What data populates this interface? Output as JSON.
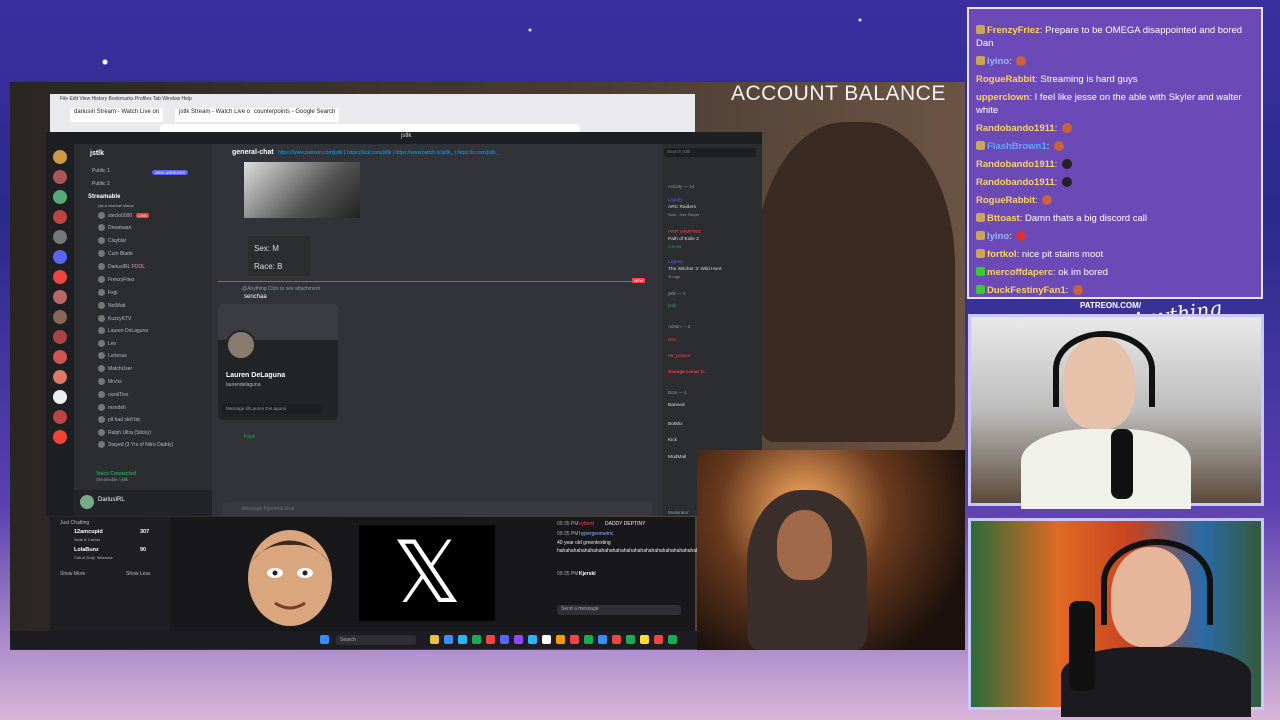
{
  "overlay": {
    "account_balance": "ACCOUNT BALANCE",
    "patreon_label": "PATREON.COM/",
    "signature": "Anything Else?"
  },
  "browser": {
    "menu": "File  Edit  View  History  Bookmarks  Profiles  Tab  Window  Help",
    "tabs": [
      "dariusiri Stream - Watch Live on",
      "jstlk Stream - Watch Live on",
      "counterpoints - Google Search"
    ]
  },
  "discord": {
    "title": "jstlk",
    "server_name": "jstlk",
    "new_unreads": "NEW UNREADS",
    "categories": [
      "Public 1",
      "Public 2",
      "Streamable"
    ],
    "streamable_sub": "(as a channel status",
    "voice_users": [
      {
        "name": "steclo0000",
        "live": "LIVE"
      },
      {
        "name": "Dreamaan"
      },
      {
        "name": "Clayblar"
      },
      {
        "name": "Cum Blade"
      },
      {
        "name": "DariusIRL",
        "tag": "FOOL"
      },
      {
        "name": "FrenzyFriez"
      },
      {
        "name": "Fxgi"
      },
      {
        "name": "NotMatt"
      },
      {
        "name": "KuzzyKTV"
      },
      {
        "name": "Lauren DeLaguna"
      },
      {
        "name": "Lev"
      },
      {
        "name": "Lorlesus"
      },
      {
        "name": "MatchUser"
      },
      {
        "name": "Mrchs"
      },
      {
        "name": "ouralTios"
      },
      {
        "name": "mxndeh"
      },
      {
        "name": "plt bad skill btc"
      },
      {
        "name": "Ralph Ultra (Sticky)"
      },
      {
        "name": "Stayed (3 Yrs of Nitro Daddy)"
      }
    ],
    "voice_connected": "Voice Connected",
    "voice_sub": "Streamable / jstlk",
    "self_user": "DariusIRL",
    "self_status": "In voice",
    "channel_name": "general-chat",
    "channel_links": "https://www.patreon.com/jstlk | https://kick.com/jstlk | https://www.twitch.tv/jstlk_ | https://x.com/jstlk_",
    "message_box": {
      "line1": "Sex: M",
      "line2": "Race: B"
    },
    "new_tag": "NEW",
    "attachment_msg": "@Anything Click to see attachment",
    "reply_user": "senchaa",
    "popup": {
      "name": "Lauren DeLaguna",
      "username": "laurendelaguna",
      "message_placeholder": "Message @Lauren DeLaguna"
    },
    "last_msg_user": "Fapn",
    "composer_placeholder": "Message #general-chat",
    "search_placeholder": "Search jstlk",
    "members": {
      "activity_header": "Activity — 14",
      "activities": [
        {
          "user": "Lrguey",
          "game": "ARC Raiders",
          "sub": "Solo - Dev Player"
        },
        {
          "user": "PRR VAMPIRE",
          "game": "Path of Exile 2",
          "sub": "2:19:54"
        },
        {
          "user": "Lrguey",
          "game": "The Witcher 3: Wild Hunt",
          "sub": "3h ago"
        }
      ],
      "owner_header": "jstlk — 1",
      "owner": "jstlk",
      "admin_header": "Admin — 3",
      "admins": [
        "Riot",
        "Mr_poison",
        "Savage Lunar C."
      ],
      "bots_header": "Bots — 4",
      "bots": [
        "Banned",
        "BotMix",
        "Kick",
        "ModMail"
      ],
      "moderator_header": "Moderator"
    }
  },
  "twitch_sidebar": {
    "section": "Just Chatting",
    "channels": [
      {
        "name": "12amcupid",
        "category": "Slots & Casino",
        "viewers": "307"
      },
      {
        "name": "LolaBunz",
        "category": "Call of Duty: Warzone",
        "viewers": "90"
      }
    ],
    "show_more": "Show More",
    "show_less": "Show Less"
  },
  "twitch_chat": {
    "messages": [
      {
        "time": "09:35 PM",
        "user": "cyberd",
        "text": "DADDY DEPTINY"
      },
      {
        "time": "09:35 PM",
        "user": "hypergeometric",
        "text": "40 year old greentexting hahahahahahahahahahahahahahahahahahahahahahahahahahahahahaha"
      },
      {
        "time": "09:35 PM",
        "user": "Kjerski",
        "text": ""
      }
    ],
    "send_placeholder": "Send a message"
  },
  "taskbar": {
    "search": "Search"
  },
  "stream_chat": [
    {
      "user": "FrenzyFriez",
      "color": "#ffd25a",
      "text": "Prepare to be OMEGA disappointed and bored Dan"
    },
    {
      "user": "lyino",
      "color": "#9ab7ff",
      "text": ""
    },
    {
      "user": "RogueRabbit",
      "color": "#ffd25a",
      "text": "Streaming is hard guys"
    },
    {
      "user": "upperclown",
      "color": "#ffd25a",
      "text": "I feel like jesse on the able with Skyler and walter white"
    },
    {
      "user": "Randobando1911",
      "color": "#ffd25a",
      "text": ""
    },
    {
      "user": "FlashBrown1",
      "color": "#63a6ff",
      "text": ""
    },
    {
      "user": "Randobando1911",
      "color": "#ffd25a",
      "text": ""
    },
    {
      "user": "Randobando1911",
      "color": "#ffd25a",
      "text": ""
    },
    {
      "user": "RogueRabbit",
      "color": "#ffd25a",
      "text": ""
    },
    {
      "user": "Bttoast",
      "color": "#ffd25a",
      "text": "Damn thats a big discord call"
    },
    {
      "user": "lyino",
      "color": "#9ab7ff",
      "text": ""
    },
    {
      "user": "fortkol",
      "color": "#ffd25a",
      "text": "nice pit stains moot"
    },
    {
      "user": "mercoffdaperc",
      "color": "#ffd25a",
      "text": "ok im bored"
    },
    {
      "user": "DuckFestinyFan1",
      "color": "#ffd25a",
      "text": ""
    }
  ]
}
